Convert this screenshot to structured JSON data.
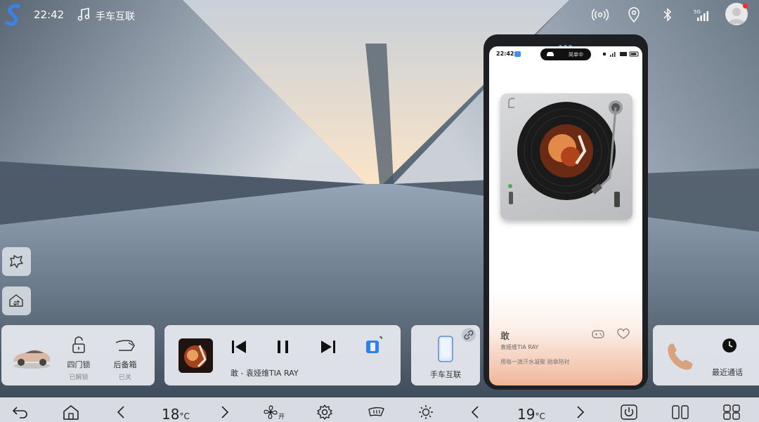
{
  "status_bar": {
    "time": "22:42",
    "app_name": "手车互联",
    "icons": [
      "s-logo",
      "music-note-icon",
      "hotspot-icon",
      "location-icon",
      "bluetooth-icon",
      "signal-5g-icon",
      "avatar"
    ],
    "network": "5G"
  },
  "floating_buttons": [
    "puzzle-icon",
    "home-share-icon"
  ],
  "vehicle_card": {
    "door_lock": {
      "label": "四门锁",
      "status": "已解锁"
    },
    "trunk": {
      "label": "后备箱",
      "status": "已关"
    }
  },
  "music_card": {
    "song_line": "敢 - 袁娅维TIA RAY",
    "controls": [
      "previous-icon",
      "pause-icon",
      "next-icon",
      "cast-icon"
    ]
  },
  "link_card": {
    "label": "手车互联"
  },
  "phone_card": {
    "recent_label": "最近通话"
  },
  "phone_mirror": {
    "time": "22:42",
    "pill_text": "简单中",
    "song_title": "敢",
    "artist": "袁娅维TIA RAY",
    "lyric": "用每一滴汗水凝聚 勋章陪衬"
  },
  "dock": {
    "left_temp": "18",
    "right_temp": "19",
    "temp_unit": "°C",
    "fan_state": "开",
    "icons": [
      "back-icon",
      "home-icon",
      "chevron-left-icon",
      "chevron-right-icon",
      "fan-icon",
      "settings-icon",
      "windshield-defrost-icon",
      "brightness-icon",
      "chevron-left-icon",
      "chevron-right-icon",
      "power-icon",
      "split-screen-icon",
      "apps-grid-icon"
    ]
  },
  "colors": {
    "accent_blue": "#3f8ff0",
    "card_bg": "#e8ebf0",
    "dock_bg": "#d8dce2",
    "notification_dot": "#ff2a2a"
  }
}
